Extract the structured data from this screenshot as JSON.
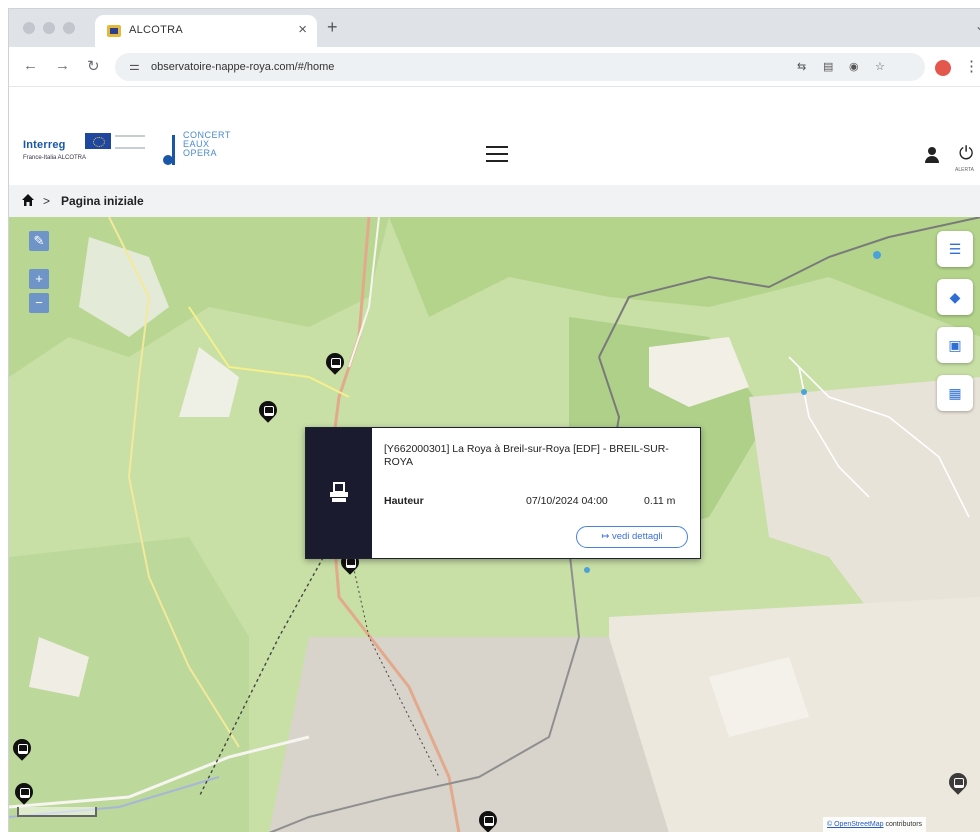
{
  "browser": {
    "tab_title": "ALCOTRA",
    "tab_close": "×",
    "new_tab": "+",
    "url": "observatoire-nappe-roya.com/#/home"
  },
  "header": {
    "interreg_word": "Interreg",
    "interreg_sub": "France-Italia ALCOTRA",
    "concert_logo": "CONCERT\nEAUX\nOPERA",
    "power_label": "ALERTA"
  },
  "breadcrumb": {
    "separator": ">",
    "current": "Pagina iniziale"
  },
  "map": {
    "zoom_in": "+",
    "zoom_out": "−",
    "edit": "✎",
    "attribution_link": "© OpenStreetMap",
    "attribution_text": "contributors"
  },
  "popup": {
    "title": "[Y662000301] La Roya à Breil-sur-Roya [EDF] - BREIL-SUR-ROYA",
    "measure_label": "Hauteur",
    "date": "07/10/2024 04:00",
    "value": "0.11 m",
    "details_button": "↦ vedi dettagli"
  },
  "icons": [
    "back-arrow-icon",
    "forward-arrow-icon",
    "reload-icon",
    "home-icon",
    "menu-icon",
    "user-icon",
    "power-icon",
    "list-icon",
    "layers-icon",
    "image-icon",
    "calendar-icon",
    "station-marker-icon",
    "zoom-in-icon",
    "zoom-out-icon"
  ]
}
